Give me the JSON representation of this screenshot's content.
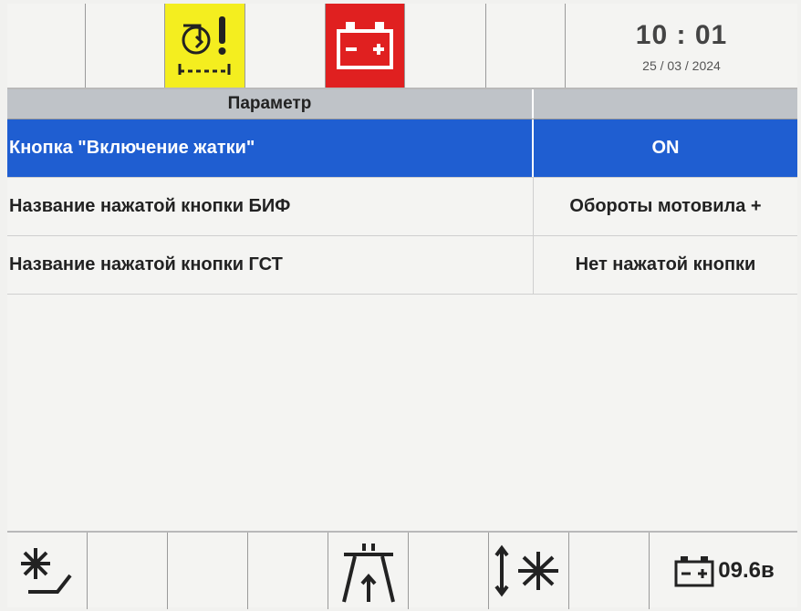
{
  "top_bar": {
    "time": "10 : 01",
    "date": "25 / 03 / 2024",
    "icons": [
      "header-drive-warning-icon",
      "battery-warning-icon"
    ]
  },
  "table": {
    "header": "Параметр",
    "rows": [
      {
        "name": "Кнопка \"Включение жатки\"",
        "value": "ON",
        "selected": true
      },
      {
        "name": "Название нажатой кнопки БИФ",
        "value": "Обороты мотовила +",
        "selected": false
      },
      {
        "name": "Название нажатой кнопки ГСТ",
        "value": "Нет нажатой кнопки",
        "selected": false
      }
    ]
  },
  "bottom_bar": {
    "icons": [
      "reel-tilt-icon",
      "road-mode-icon",
      "reel-height-icon",
      "battery-icon"
    ],
    "battery_voltage": "09.6в"
  },
  "colors": {
    "selection": "#1f5ed1",
    "warning_yellow": "#f4ee1f",
    "alarm_red": "#e02020",
    "header_bg": "#bfc3c8"
  }
}
